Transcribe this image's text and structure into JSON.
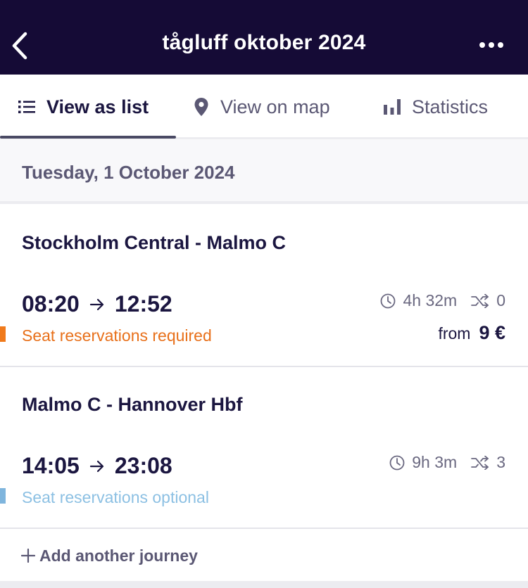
{
  "header": {
    "title": "tågluff oktober 2024",
    "back_icon": "chevron-left-icon",
    "more_icon": "more-horizontal-icon",
    "background": "#150b36"
  },
  "tabs": [
    {
      "label": "View as list",
      "icon": "list-icon",
      "active": true
    },
    {
      "label": "View on map",
      "icon": "map-pin-icon",
      "active": false
    },
    {
      "label": "Statistics",
      "icon": "bar-chart-icon",
      "active": false
    }
  ],
  "day": {
    "date": "Tuesday, 1 October 2024"
  },
  "journeys": [
    {
      "route": "Stockholm Central - Malmo C",
      "departure": "08:20",
      "arrival": "12:52",
      "duration": "4h 32m",
      "changes": "0",
      "seat_note": "Seat reservations required",
      "seat_color": "#e8701a",
      "price_prefix": "from",
      "price": "9 €"
    },
    {
      "route": "Malmo C - Hannover Hbf",
      "departure": "14:05",
      "arrival": "23:08",
      "duration": "9h 3m",
      "changes": "3",
      "seat_note": "Seat reservations optional",
      "seat_color": "#8cc0e3"
    }
  ],
  "add_journey": {
    "label": "Add another journey",
    "icon": "plus-icon"
  }
}
